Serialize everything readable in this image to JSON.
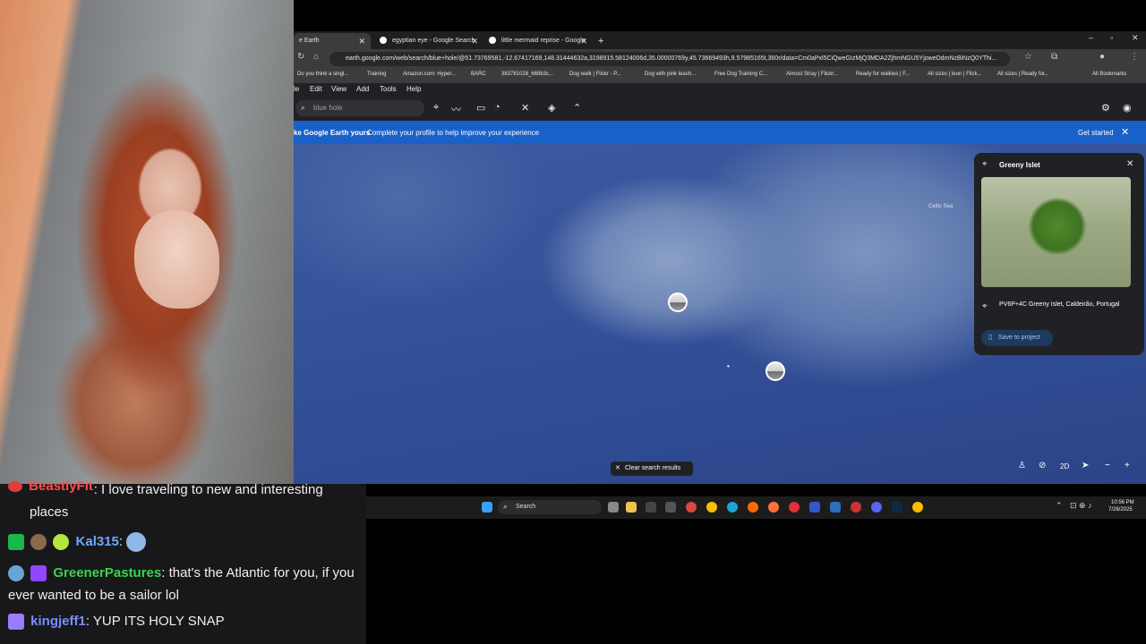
{
  "browser": {
    "tabs": [
      {
        "label": "e Earth",
        "active": true
      },
      {
        "label": "egyptian eye - Google Search",
        "active": false
      },
      {
        "label": "little mermaid reprise - Google",
        "active": false
      }
    ],
    "url": "earth.google.com/web/search/blue+hole/@51.73769581,-12.67417169,148.31444632a,3198915.58124006d,35.00000769y,45.73669493h,9.57985165t,360r/data=Cm0aPxl5CiQweGIzMjQ3MDA2ZjhmNGU5YjoweDdmNzBiNzQ0YThi...",
    "bookmarks": [
      "Do you think a singl...",
      "Training",
      "Amazon.com: Hyper...",
      "BARC",
      "383781028_669b3c...",
      "Dog walk | Flickr - P...",
      "Dog with pink leash...",
      "Free Dog Training C...",
      "Almost Stray | Flickr...",
      "Ready for walkies | F...",
      "All sizes | leon | Flick...",
      "All sizes | Ready for..."
    ],
    "all_bookmarks": "All Bookmarks",
    "menu": [
      "le",
      "Edit",
      "View",
      "Add",
      "Tools",
      "Help"
    ]
  },
  "earth": {
    "search_value": "blue hole",
    "banner": {
      "text_bold": "ke Google Earth yours",
      "text": "Complete your profile to help improve your experience",
      "cta": "Get started"
    },
    "map_label": "Celtic Sea",
    "info": {
      "title": "Greeny Islet",
      "address": "PV6P+4C Greeny Islet, Caldeirão, Portugal",
      "save": "Save to project"
    },
    "clear": "Clear search results",
    "view_mode": "2D"
  },
  "taskbar": {
    "search": "Search",
    "time": "10:56 PM",
    "date": "7/28/2025"
  },
  "chat": [
    {
      "user": "BeastlyFit",
      "user_color": "#ff4d4d",
      "text": ": I love traveling to new and interesting places"
    },
    {
      "user": "Kal315",
      "user_color": "#6aa9ff",
      "text": ":"
    },
    {
      "user": "GreenerPastures",
      "user_color": "#3cd24f",
      "text": ": that's the Atlantic for you, if you ever wanted to be a sailor lol"
    },
    {
      "user": "kingjeff1",
      "user_color": "#7b8cff",
      "text": ": YUP ITS HOLY SNAP"
    }
  ]
}
